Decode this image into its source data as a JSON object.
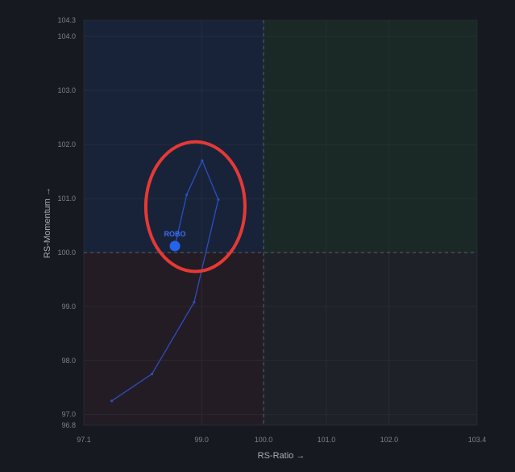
{
  "chart_data": {
    "type": "scatter",
    "title": "",
    "xlabel": "RS-Ratio →",
    "ylabel": "RS-Momentum →",
    "xlim": [
      97.1,
      103.4
    ],
    "ylim": [
      96.8,
      104.3
    ],
    "x_ticks": [
      97.1,
      99.0,
      100.0,
      101.0,
      102.0,
      103.4
    ],
    "x_tick_labels": [
      "97.1",
      "99.0",
      "100.0",
      "101.0",
      "102.0",
      "103.4"
    ],
    "y_ticks": [
      96.8,
      97.0,
      98.0,
      99.0,
      100.0,
      101.0,
      102.0,
      103.0,
      104.0,
      104.3
    ],
    "y_tick_labels": [
      "96.8",
      "97.0",
      "98.0",
      "99.0",
      "100.0",
      "101.0",
      "102.0",
      "103.0",
      "104.0",
      "104.3"
    ],
    "grid": true,
    "center": [
      100.0,
      100.0
    ],
    "quadrant_colors": {
      "top_left": "#18233a",
      "top_right": "#1a2826",
      "bottom_left": "#241c24",
      "bottom_right": "#1e2228"
    },
    "series": [
      {
        "name": "ROBO",
        "color": "#2b4ec0",
        "head_color": "#2563eb",
        "points": [
          {
            "x": 97.55,
            "y": 97.25
          },
          {
            "x": 98.2,
            "y": 97.75
          },
          {
            "x": 98.88,
            "y": 99.08
          },
          {
            "x": 99.27,
            "y": 100.98
          },
          {
            "x": 99.01,
            "y": 101.7
          },
          {
            "x": 98.76,
            "y": 101.07
          },
          {
            "x": 98.57,
            "y": 100.12
          }
        ]
      }
    ],
    "annotations": [
      {
        "type": "ellipse",
        "color": "#e53935",
        "cx": 98.9,
        "cy": 100.85,
        "rx": 0.8,
        "ry": 1.2
      }
    ]
  }
}
